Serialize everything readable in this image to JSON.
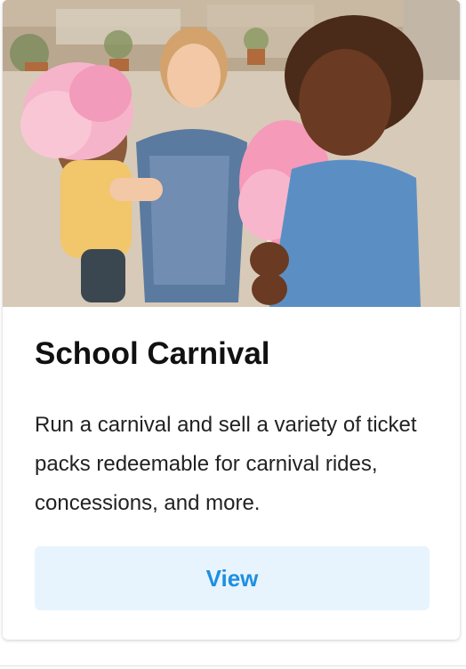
{
  "card": {
    "image_alt": "Children eating pink cotton candy at a carnival",
    "title": "School Carnival",
    "description": "Run a carnival and sell a variety of ticket packs redeemable for carnival rides, concessions, and more.",
    "button_label": "View"
  },
  "colors": {
    "button_bg": "#e8f4fd",
    "button_text": "#1e8fe1",
    "cotton_candy": "#f6a9c3"
  }
}
